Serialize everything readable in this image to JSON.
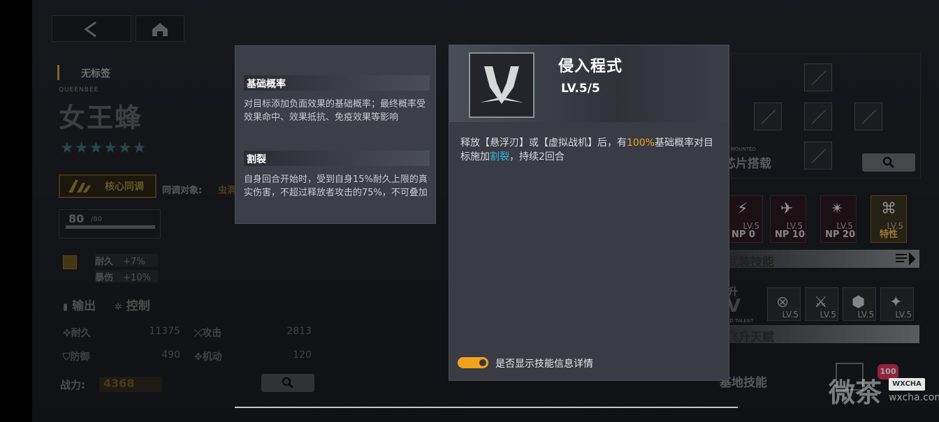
{
  "colors": {
    "accent_orange": "#f2a21d",
    "accent_blue": "#2fb8e8",
    "panel": "#393c44"
  },
  "nav": {
    "back_icon": "chevron-left-icon",
    "home_icon": "home-icon"
  },
  "character": {
    "tag": "无标签",
    "codename": "QUEENBEE",
    "name": "女王蜂",
    "stars": "★★★★★★",
    "core_sync_label": "核心同调",
    "sync_target_label": "同调对象:",
    "sync_target_value": "虫洞",
    "level_current": "80",
    "level_max": "/80",
    "level_progress_fraction": 1.0,
    "bonus_1_label": "耐久",
    "bonus_1_value": "+7%",
    "bonus_2_label": "暴伤",
    "bonus_2_value": "+10%",
    "role_1": "输出",
    "role_2": "控制",
    "stats": {
      "hp_label": "耐久",
      "hp_value": "11375",
      "atk_label": "攻击",
      "atk_value": "2813",
      "def_label": "防御",
      "def_value": "490",
      "mob_label": "机动",
      "mob_value": "120"
    },
    "power_label": "战力:",
    "power_value": "4368"
  },
  "right_panel": {
    "chip_subtitle": "MOUNTED",
    "chip_title": "芯片搭载",
    "skills": [
      {
        "lv": "5",
        "label": "NP  0"
      },
      {
        "lv": "5",
        "label": "NP  10"
      },
      {
        "lv": "5",
        "label": "NP  20"
      },
      {
        "lv": "5",
        "label": "特性"
      }
    ],
    "equip_skill_title": "武装技能",
    "ascend_prefix": "升",
    "ascend_roman": "V",
    "ascend_subtitle": "ED TALENT",
    "talents": [
      {
        "lv": "5"
      },
      {
        "lv": "5"
      },
      {
        "lv": "5"
      },
      {
        "lv": "5"
      }
    ],
    "ascend_title": "飞升天赋",
    "base_skill_title": "基地技能",
    "badge_value": "100"
  },
  "tooltip_terms": {
    "term_1_title": "基础概率",
    "term_1_desc": "对目标添加负面效果的基础概率；最终概率受效果命中、效果抵抗、免疫效果等影响",
    "term_2_title": "割裂",
    "term_2_desc": "自身回合开始时，受到自身15%耐久上限的真实伤害，不超过释放者攻击的75%，不可叠加"
  },
  "skill_detail": {
    "name": "侵入程式",
    "level": "LV.5/5",
    "desc_part_1": "释放【悬浮刃】或【虚拟战机】后，有",
    "desc_highlight_1": "100%",
    "desc_part_2": "基础概率对目标施加",
    "desc_highlight_2": "割裂",
    "desc_part_3": "，持续2回合",
    "toggle_label": "是否显示技能信息详情",
    "toggle_on": true
  },
  "watermark": {
    "text": "微茶",
    "badge": "WXCHA",
    "url": "wxcha.com"
  }
}
